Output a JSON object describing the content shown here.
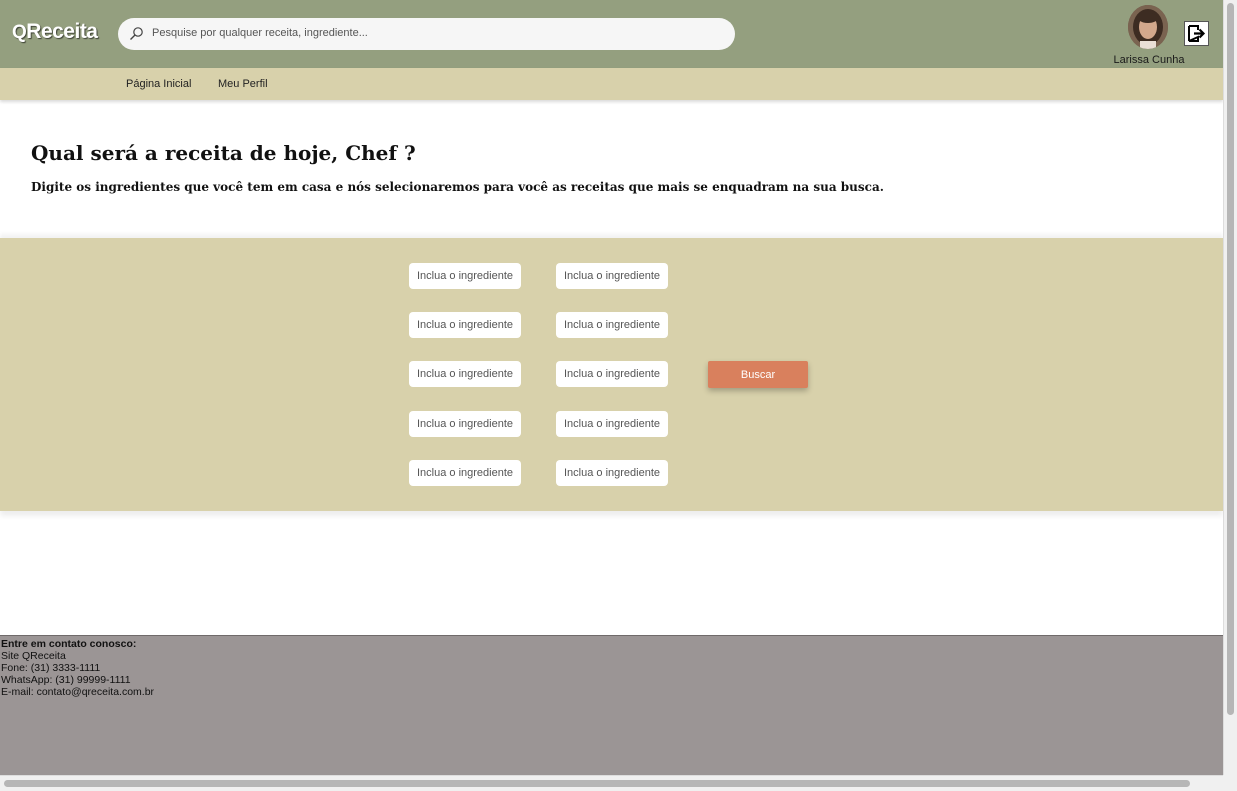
{
  "header": {
    "logo_q": "Q",
    "logo_text": "Receita",
    "search_placeholder": "Pesquise por qualquer receita, ingrediente...",
    "user_name": "Larissa Cunha",
    "logout_icon": "logout-icon"
  },
  "nav": {
    "items": [
      {
        "label": "Página Inicial"
      },
      {
        "label": "Meu Perfil"
      }
    ]
  },
  "hero": {
    "title": "Qual será a receita de hoje, Chef ?",
    "subtitle": "Digite os ingredientes que você tem em casa e nós selecionaremos para você as receitas que mais se enquadram na sua busca."
  },
  "ingredients": {
    "placeholder": "Inclua o ingrediente",
    "count": 10,
    "search_button": "Buscar"
  },
  "footer": {
    "heading": "Entre em contato conosco:",
    "lines": [
      "Site QReceita",
      "Fone: (31) 3333-1111",
      "WhatsApp: (31) 99999-1111",
      "E-mail: contato@qreceita.com.br"
    ]
  },
  "colors": {
    "header_bg": "#949f7f",
    "nav_bg": "#d8d1ab",
    "button_bg": "#d9805d",
    "footer_bg": "#9b9595"
  }
}
